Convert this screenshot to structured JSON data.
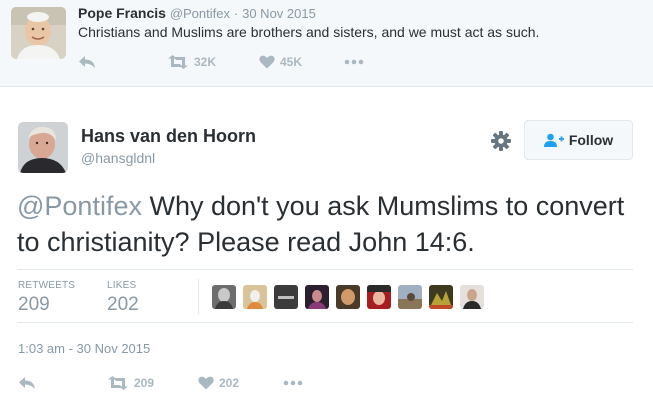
{
  "parent_tweet": {
    "author_name": "Pope Francis",
    "author_handle": "@Pontifex",
    "separator": "·",
    "date": "30 Nov 2015",
    "text": "Christians and Muslims are brothers and sisters, and we must act as such.",
    "actions": {
      "reply_icon": "reply-icon",
      "retweet_icon": "retweet-icon",
      "retweet_count": "32K",
      "like_icon": "heart-icon",
      "like_count": "45K",
      "more_icon": "more-icon"
    }
  },
  "main_tweet": {
    "author_name": "Hans van den Hoorn",
    "author_handle": "@hansgldnl",
    "settings_icon": "gear-icon",
    "follow_button": {
      "icon": "follow-user-icon",
      "label": "Follow"
    },
    "mention": "@Pontifex",
    "text": " Why don't you ask Mumslims to convert to christianity? Please read John 14:6.",
    "stats": {
      "retweets_label": "RETWEETS",
      "retweets_value": "209",
      "likes_label": "LIKES",
      "likes_value": "202"
    },
    "liked_by_avatar_count": 9,
    "timestamp": "1:03 am - 30 Nov 2015",
    "actions": {
      "reply_icon": "reply-icon",
      "retweet_icon": "retweet-icon",
      "retweet_count": "209",
      "like_icon": "heart-icon",
      "like_count": "202",
      "more_icon": "more-icon"
    }
  },
  "colors": {
    "text_primary": "#292f33",
    "text_secondary": "#8899a6",
    "icon_gray": "#aab8c2",
    "follow_icon_blue": "#1da1f2",
    "parent_background": "#f5f8fa",
    "border": "#e1e8ed"
  }
}
